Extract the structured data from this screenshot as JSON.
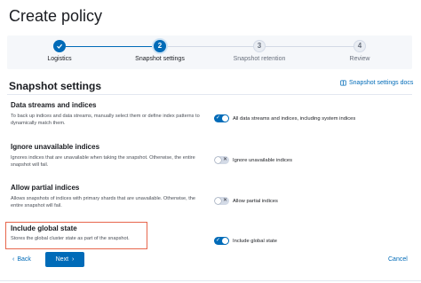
{
  "page": {
    "title": "Create policy"
  },
  "stepper": {
    "steps": [
      {
        "number": "1",
        "label": "Logistics",
        "state": "complete"
      },
      {
        "number": "2",
        "label": "Snapshot settings",
        "state": "current"
      },
      {
        "number": "3",
        "label": "Snapshot retention",
        "state": "incomplete"
      },
      {
        "number": "4",
        "label": "Review",
        "state": "incomplete"
      }
    ]
  },
  "section": {
    "title": "Snapshot settings",
    "docs_link": "Snapshot settings docs",
    "docs_icon": "book-icon"
  },
  "options": [
    {
      "title": "Data streams and indices",
      "description": "To back up indices and data streams, manually select them or define index patterns to dynamically match them.",
      "switch_label": "All data streams and indices, including system indices",
      "checked": true
    },
    {
      "title": "Ignore unavailable indices",
      "description": "Ignores indices that are unavailable when taking the snapshot. Otherwise, the entire snapshot will fail.",
      "switch_label": "Ignore unavailable indices",
      "checked": false
    },
    {
      "title": "Allow partial indices",
      "description": "Allows snapshots of indices with primary shards that are unavailable. Otherwise, the entire snapshot will fail.",
      "switch_label": "Allow partial indices",
      "checked": false
    },
    {
      "title": "Include global state",
      "description": "Stores the global cluster state as part of the snapshot.",
      "switch_label": "Include global state",
      "checked": true
    }
  ],
  "footer": {
    "back_label": "Back",
    "next_label": "Next",
    "cancel_label": "Cancel"
  },
  "colors": {
    "primary": "#006bb8",
    "highlight": "#e7664c",
    "stepper_bg": "#f5f7fa"
  }
}
